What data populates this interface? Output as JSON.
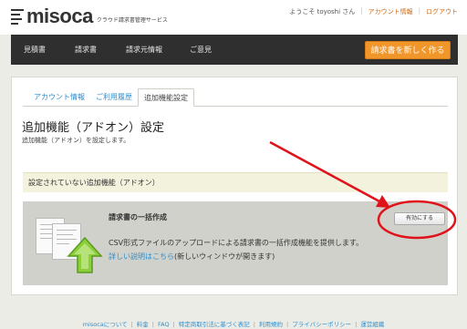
{
  "header": {
    "logo_text": "misoca",
    "logo_sub": "クラウド請求書管理サービス",
    "greeting": "ようこそ toyoshi さん",
    "account_link": "アカウント情報",
    "logout_link": "ログアウト"
  },
  "nav": {
    "items": [
      {
        "label": "見積書"
      },
      {
        "label": "請求書"
      },
      {
        "label": "請求元情報"
      },
      {
        "label": "ご意見"
      }
    ],
    "cta_label": "請求書を新しく作る"
  },
  "tabs": [
    {
      "label": "アカウント情報",
      "active": false
    },
    {
      "label": "ご利用履歴",
      "active": false
    },
    {
      "label": "追加機能設定",
      "active": true
    }
  ],
  "page": {
    "title": "追加機能（アドオン）設定",
    "subtitle": "追加機能（アドオン）を設定します。"
  },
  "section": {
    "title": "設定されていない追加機能（アドオン）"
  },
  "addon": {
    "name": "請求書の一括作成",
    "description": "CSV形式ファイルのアップロードによる請求書の一括作成機能を提供します。",
    "link_label": "詳しい説明はこちら",
    "link_suffix": "(新しいウィンドウが開きます)",
    "enable_button": "有効にする"
  },
  "annotation": {
    "color": "#e0121a"
  },
  "footer": {
    "links": [
      "misocaについて",
      "料金",
      "FAQ",
      "特定商取引法に基づく表記",
      "利用規約",
      "プライバシーポリシー",
      "運営組織"
    ]
  },
  "colors": {
    "accent": "#f0962a",
    "link": "#2e8fcf",
    "nav_bg": "#2f2f2f"
  }
}
